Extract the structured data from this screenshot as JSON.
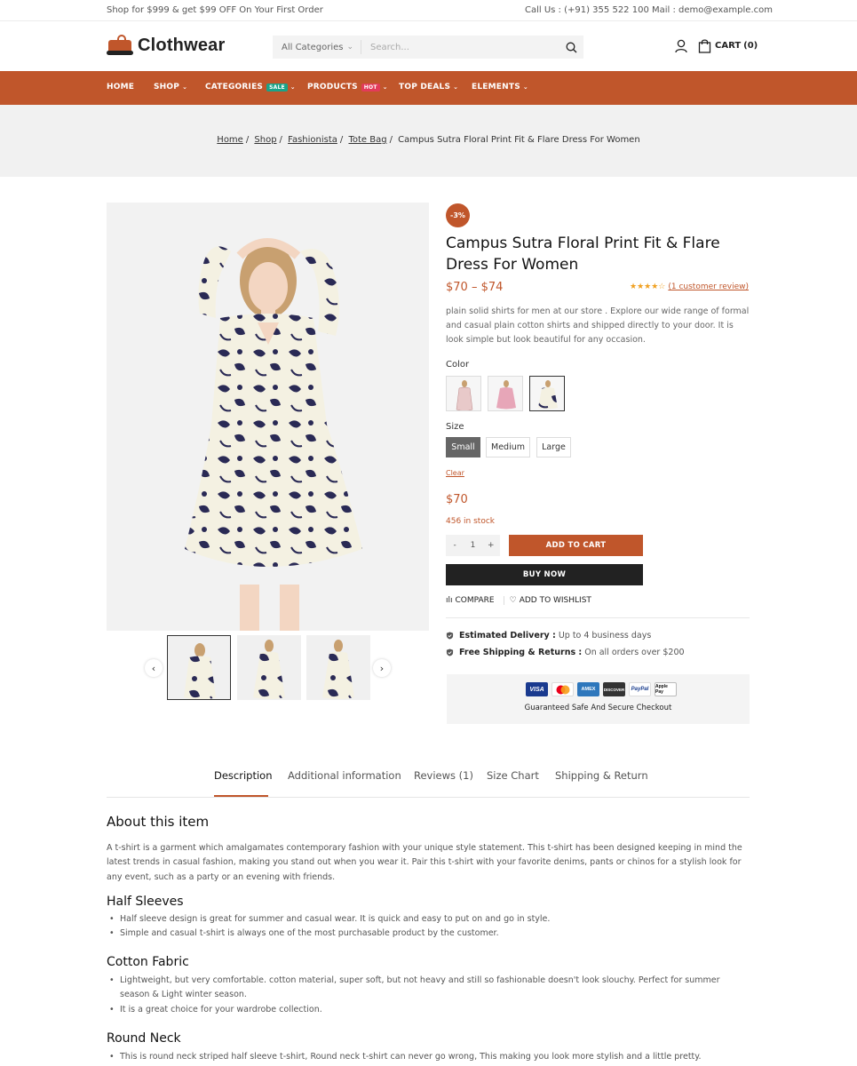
{
  "topbar": {
    "promo": "Shop for $999 & get $99 OFF On Your First Order",
    "call": "Call Us : (+91) 355 522 100",
    "mail": "Mail : demo@example.com"
  },
  "header": {
    "logo_text": "Clothwear",
    "search_category": "All Categories",
    "search_placeholder": "Search...",
    "cart_label": "CART",
    "cart_count": "(0)"
  },
  "nav": {
    "items": [
      {
        "label": "HOME"
      },
      {
        "label": "SHOP"
      },
      {
        "label": "CATEGORIES",
        "badge": "SALE"
      },
      {
        "label": "PRODUCTS",
        "badge": "HOT"
      },
      {
        "label": "TOP DEALS"
      },
      {
        "label": "ELEMENTS"
      }
    ]
  },
  "breadcrumb": {
    "items": [
      "Home",
      "Shop",
      "Fashionista",
      "Tote Bag"
    ],
    "current": "Campus Sutra Floral Print Fit & Flare Dress For Women"
  },
  "product": {
    "discount": "-3%",
    "title": "Campus Sutra Floral Print Fit & Flare Dress For Women",
    "price_range": "$70 – $74",
    "rating_value": 4,
    "rating_max": 5,
    "review_link": "(1 customer review)",
    "description": "plain solid shirts for men at our store . Explore our wide range of formal and casual plain cotton shirts and shipped directly to your door. It is look simple but look beautiful for any occasion.",
    "color_label": "Color",
    "size_label": "Size",
    "sizes": [
      "Small",
      "Medium",
      "Large"
    ],
    "selected_size": "Small",
    "clear_label": "Clear",
    "selected_price": "$70",
    "stock": "456 in stock",
    "qty": "1",
    "qty_minus": "-",
    "qty_plus": "+",
    "add_to_cart": "ADD TO CART",
    "buy_now": "BUY NOW",
    "compare": "COMPARE",
    "wishlist": "ADD TO WISHLIST",
    "delivery_label": "Estimated Delivery :",
    "delivery_value": "Up to 4 business days",
    "shipping_label": "Free Shipping & Returns :",
    "shipping_value": "On all orders over $200",
    "payment_cards": [
      "VISA",
      "Mastercard",
      "AMEX",
      "DISCOVER",
      "PayPal",
      "Apple Pay"
    ],
    "secure_text": "Guaranteed Safe And Secure Checkout"
  },
  "tabs": {
    "items": [
      "Description",
      "Additional information",
      "Reviews (1)",
      "Size Chart",
      "Shipping & Return"
    ],
    "active": "Description"
  },
  "content": {
    "about_title": "About this item",
    "about_text": "A t-shirt is a garment which amalgamates contemporary fashion with your unique style statement. This t-shirt has been designed keeping in mind the latest trends in casual fashion, making you stand out when you wear it. Pair this t-shirt with your favorite denims, pants or chinos for a stylish look for any event, such as a party or an evening with friends.",
    "sections": [
      {
        "title": "Half Sleeves",
        "bullets": [
          "Half sleeve design is great for summer and casual wear. It is quick and easy to put on and go in style.",
          "Simple and casual t-shirt is always one of the most purchasable product by the customer."
        ]
      },
      {
        "title": "Cotton Fabric",
        "bullets": [
          "Lightweight, but very comfortable. cotton material, super soft, but not heavy and still so fashionable doesn't look slouchy. Perfect for summer season & Light winter season.",
          "It is a great choice for your wardrobe collection."
        ]
      },
      {
        "title": "Round Neck",
        "bullets": [
          "This is round neck striped half sleeve t-shirt, Round neck t-shirt can never go wrong, This making you look more stylish and a little pretty."
        ]
      }
    ]
  },
  "colors": {
    "accent": "#c0562b",
    "dark": "#222222",
    "sale_badge": "#1aa388",
    "hot_badge": "#e23b5a"
  }
}
